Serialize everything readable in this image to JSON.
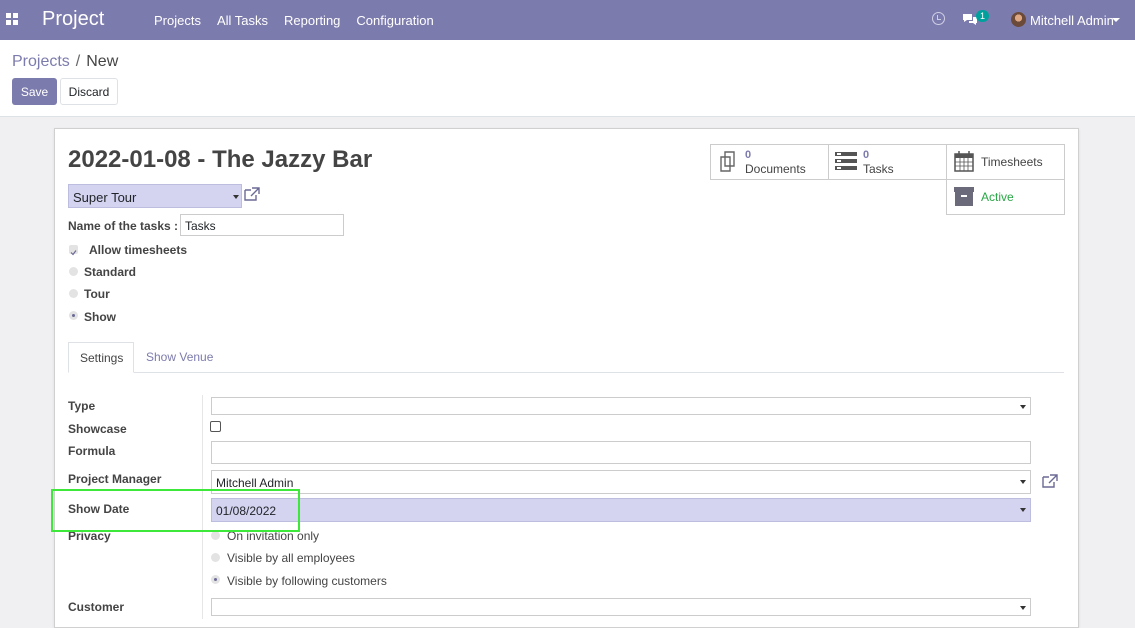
{
  "navbar": {
    "app_name": "Project",
    "menu": [
      "Projects",
      "All Tasks",
      "Reporting",
      "Configuration"
    ],
    "chat_count": "1",
    "user_name": "Mitchell Admin",
    "color": "#7c7bad"
  },
  "breadcrumb": {
    "parent": "Projects",
    "separator": "/",
    "current": "New"
  },
  "buttons": {
    "save": "Save",
    "discard": "Discard"
  },
  "record": {
    "title": "2022-01-08 - The Jazzy Bar",
    "template": "Super Tour",
    "task_name_label": "Name of the tasks :",
    "task_name_value": "Tasks",
    "allow_timesheets_label": "Allow timesheets",
    "allow_timesheets": true,
    "kind_options": [
      "Standard",
      "Tour",
      "Show"
    ],
    "kind_selected": "Show"
  },
  "smart_buttons": {
    "documents": {
      "count": "0",
      "label": "Documents"
    },
    "tasks": {
      "count": "0",
      "label": "Tasks"
    },
    "timesheets": {
      "label": "Timesheets"
    },
    "active": {
      "label": "Active",
      "color": "#28a745"
    }
  },
  "tabs": [
    "Settings",
    "Show Venue"
  ],
  "settings": {
    "type_label": "Type",
    "type_value": "",
    "showcase_label": "Showcase",
    "showcase": false,
    "formula_label": "Formula",
    "formula_value": "",
    "manager_label": "Project Manager",
    "manager_value": "Mitchell Admin",
    "show_date_label": "Show Date",
    "show_date_value": "01/08/2022",
    "privacy_label": "Privacy",
    "privacy_options": [
      "On invitation only",
      "Visible by all employees",
      "Visible by following customers"
    ],
    "privacy_selected": "Visible by following customers",
    "customer_label": "Customer",
    "customer_value": ""
  }
}
